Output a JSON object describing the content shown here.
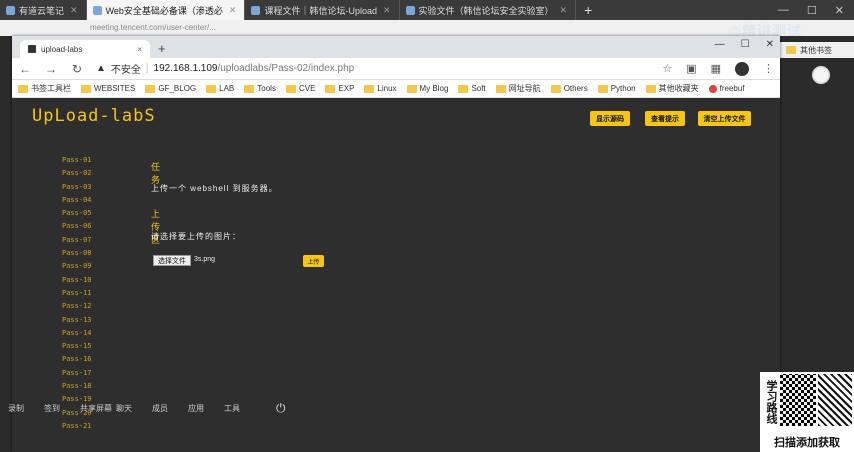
{
  "outer_tabs": [
    {
      "label": "有道云笔记",
      "active": false
    },
    {
      "label": "Web安全基础必备课（渗透必",
      "active": true
    },
    {
      "label": "课程文件｜韩信论坛-Upload",
      "active": false
    },
    {
      "label": "实验文件（韩信论坛安全实验室）",
      "active": false
    }
  ],
  "outer_url": "meeting.tencent.com/user-center/...",
  "watermark": "@精讲测试",
  "outer_bookmark_right": "其他书签",
  "inner_tab": {
    "label": "upload-labs",
    "close": "×"
  },
  "inner_addr": {
    "insecure": "不安全",
    "host": "192.168.1.109",
    "path": "/uploadlabs/Pass-02/index.php"
  },
  "bookmarks": [
    {
      "label": "书签工具栏",
      "kind": "folder"
    },
    {
      "label": "WEBSITES",
      "kind": "folder"
    },
    {
      "label": "GF_BLOG",
      "kind": "folder"
    },
    {
      "label": "LAB",
      "kind": "folder"
    },
    {
      "label": "Tools",
      "kind": "folder"
    },
    {
      "label": "CVE",
      "kind": "folder"
    },
    {
      "label": "EXP",
      "kind": "folder"
    },
    {
      "label": "Linux",
      "kind": "folder"
    },
    {
      "label": "My Blog",
      "kind": "folder"
    },
    {
      "label": "Soft",
      "kind": "folder"
    },
    {
      "label": "网址导航",
      "kind": "folder"
    },
    {
      "label": "Others",
      "kind": "folder"
    },
    {
      "label": "Python",
      "kind": "folder"
    },
    {
      "label": "其他收藏夹",
      "kind": "folder"
    },
    {
      "label": "freebuf",
      "kind": "site"
    }
  ],
  "page": {
    "logo": "UpLoad-labS",
    "buttons": {
      "source": "显示源码",
      "hint": "查看提示",
      "clear": "清空上传文件"
    },
    "passes": [
      "Pass-01",
      "Pass-02",
      "Pass-03",
      "Pass-04",
      "Pass-05",
      "Pass-06",
      "Pass-07",
      "Pass-08",
      "Pass-09",
      "Pass-10",
      "Pass-11",
      "Pass-12",
      "Pass-13",
      "Pass-14",
      "Pass-15",
      "Pass-16",
      "Pass-17",
      "Pass-18",
      "Pass-19",
      "Pass-20",
      "Pass-21"
    ],
    "task_title": "任务",
    "task_text": "上传一个 webshell 到服务器。",
    "upload_title": "上传区",
    "choose_label": "请选择要上传的图片：",
    "file_button": "选择文件",
    "file_name": "3s.png",
    "upload_button": "上传"
  },
  "bottom_bar": [
    "录制",
    "签到",
    "共享屏幕",
    "聊天",
    "成员",
    "应用",
    "工具"
  ],
  "promo": {
    "side": "学习路线",
    "bottom": "扫描添加获取"
  }
}
